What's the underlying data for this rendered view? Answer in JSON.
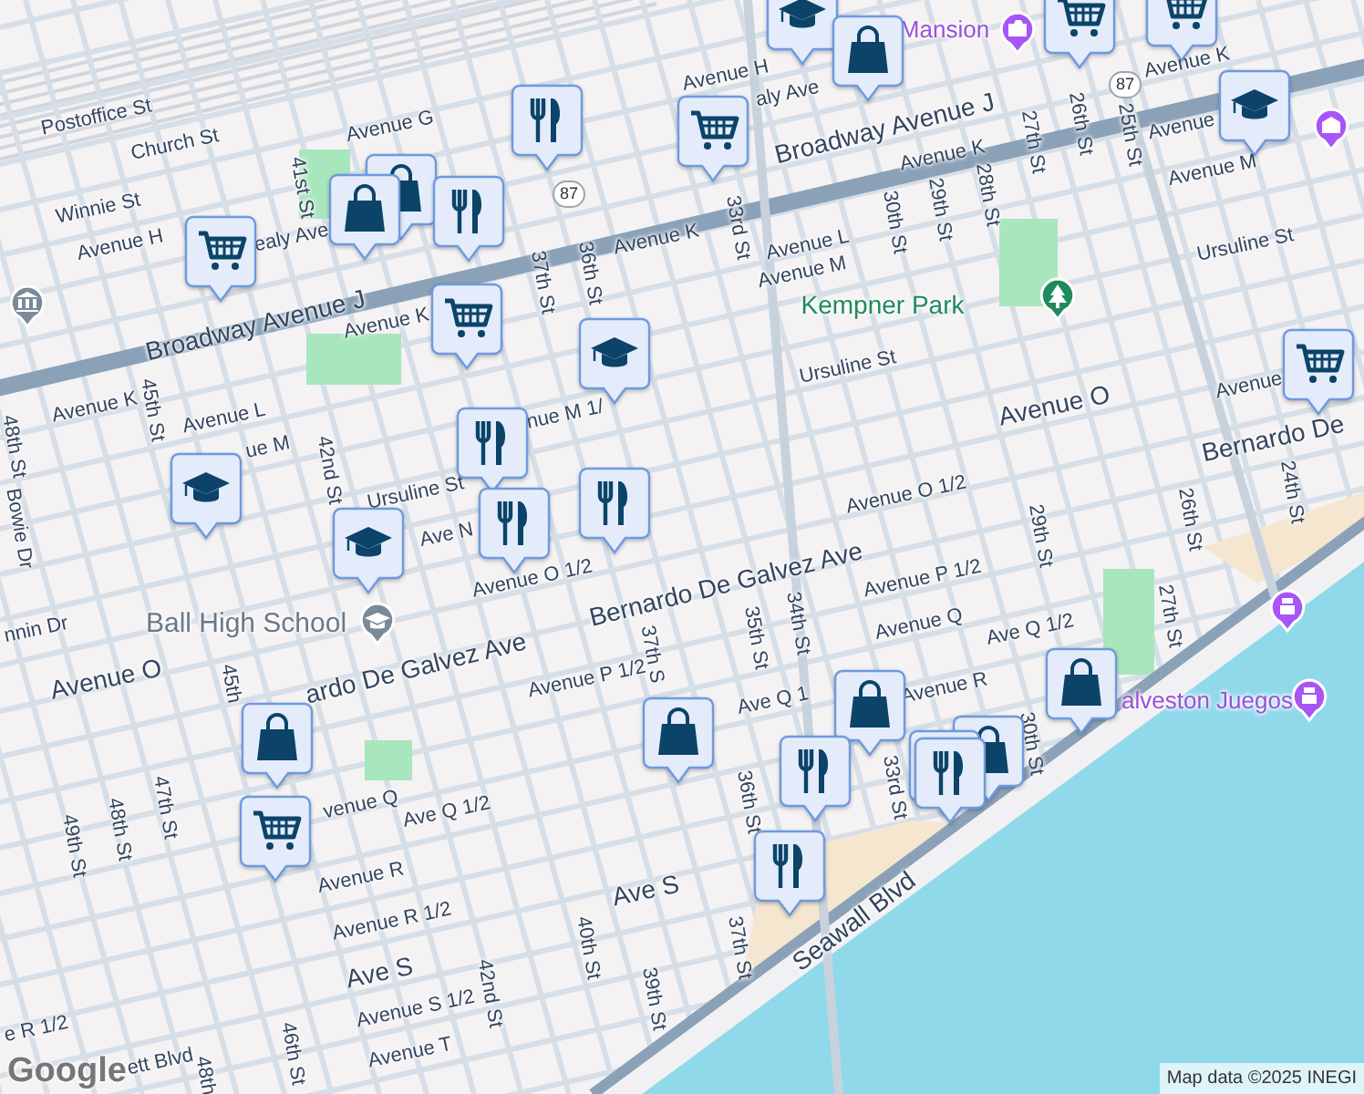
{
  "labels": [
    {
      "text": "Postoffice St",
      "kind": "street"
    },
    {
      "text": "Church St",
      "kind": "street"
    },
    {
      "text": "Avenue G",
      "kind": "street"
    },
    {
      "text": "Winnie St",
      "kind": "street"
    },
    {
      "text": "Avenue H",
      "kind": "street"
    },
    {
      "text": "ealy Ave",
      "kind": "street"
    },
    {
      "text": "41st St",
      "kind": "street"
    },
    {
      "text": "Broadway Avenue J",
      "kind": "major"
    },
    {
      "text": "Avenue K",
      "kind": "street"
    },
    {
      "text": "37th St",
      "kind": "street"
    },
    {
      "text": "36th St",
      "kind": "street"
    },
    {
      "text": "Avenue K",
      "kind": "street"
    },
    {
      "text": "Avenue L",
      "kind": "street"
    },
    {
      "text": "Avenue M",
      "kind": "street"
    },
    {
      "text": "33rd St",
      "kind": "street"
    },
    {
      "text": "30th St",
      "kind": "street"
    },
    {
      "text": "29th St",
      "kind": "street"
    },
    {
      "text": "28th St",
      "kind": "street"
    },
    {
      "text": "27th St",
      "kind": "street"
    },
    {
      "text": "26th St",
      "kind": "street"
    },
    {
      "text": "25th St",
      "kind": "street"
    },
    {
      "text": "Avenue K",
      "kind": "street"
    },
    {
      "text": "Avenue",
      "kind": "street"
    },
    {
      "text": "Avenue M",
      "kind": "street"
    },
    {
      "text": "Ursuline St",
      "kind": "street"
    },
    {
      "text": "Avenue H",
      "kind": "street"
    },
    {
      "text": "aly Ave",
      "kind": "street"
    },
    {
      "text": "Avenue K",
      "kind": "street"
    },
    {
      "text": "Broadway Avenue J",
      "kind": "major"
    },
    {
      "text": "Mansion",
      "kind": "attraction"
    },
    {
      "text": "Kempner Park",
      "kind": "park"
    },
    {
      "text": "Ursuline St",
      "kind": "street"
    },
    {
      "text": "Avenue O",
      "kind": "major"
    },
    {
      "text": "Avenue O 1/2",
      "kind": "street"
    },
    {
      "text": "Avenue",
      "kind": "street"
    },
    {
      "text": "Bernardo De",
      "kind": "major"
    },
    {
      "text": "24th St",
      "kind": "street"
    },
    {
      "text": "26th St",
      "kind": "street"
    },
    {
      "text": "29th St",
      "kind": "street"
    },
    {
      "text": "Avenue P 1/2",
      "kind": "street"
    },
    {
      "text": "Avenue Q",
      "kind": "street"
    },
    {
      "text": "Ave Q 1/2",
      "kind": "street"
    },
    {
      "text": "27th St",
      "kind": "street"
    },
    {
      "text": "alveston Juegos",
      "kind": "attraction"
    },
    {
      "text": "Seawall Blvd",
      "kind": "major"
    },
    {
      "text": "33rd St",
      "kind": "street"
    },
    {
      "text": "30th St",
      "kind": "street"
    },
    {
      "text": "36th St",
      "kind": "street"
    },
    {
      "text": "37th St",
      "kind": "street"
    },
    {
      "text": "35th St",
      "kind": "street"
    },
    {
      "text": "34th St",
      "kind": "street"
    },
    {
      "text": "Ave Q 1",
      "kind": "street"
    },
    {
      "text": "Avenue R",
      "kind": "street"
    },
    {
      "text": "Bernardo De Galvez Ave",
      "kind": "major"
    },
    {
      "text": "ardo De Galvez Ave",
      "kind": "major"
    },
    {
      "text": "Ball High School",
      "kind": "school"
    },
    {
      "text": "Avenue O",
      "kind": "major"
    },
    {
      "text": "Avenue O 1/2",
      "kind": "street"
    },
    {
      "text": "Avenue P 1/2",
      "kind": "street"
    },
    {
      "text": "37th S",
      "kind": "street"
    },
    {
      "text": "45th",
      "kind": "street"
    },
    {
      "text": "49th St",
      "kind": "street"
    },
    {
      "text": "48th St",
      "kind": "street"
    },
    {
      "text": "47th St",
      "kind": "street"
    },
    {
      "text": "venue Q",
      "kind": "street"
    },
    {
      "text": "Ave Q 1/2",
      "kind": "street"
    },
    {
      "text": "Avenue R",
      "kind": "street"
    },
    {
      "text": "Avenue R 1/2",
      "kind": "street"
    },
    {
      "text": "Ave S",
      "kind": "major"
    },
    {
      "text": "Avenue S 1/2",
      "kind": "street"
    },
    {
      "text": "Avenue T",
      "kind": "street"
    },
    {
      "text": "42nd St",
      "kind": "street"
    },
    {
      "text": "40th St",
      "kind": "street"
    },
    {
      "text": "39th St",
      "kind": "street"
    },
    {
      "text": "46th St",
      "kind": "street"
    },
    {
      "text": "48th",
      "kind": "street"
    },
    {
      "text": "ett Blvd",
      "kind": "street"
    },
    {
      "text": "e R 1/2",
      "kind": "street"
    },
    {
      "text": "Ave S",
      "kind": "major"
    },
    {
      "text": "Bowie Dr",
      "kind": "street"
    },
    {
      "text": "nnin Dr",
      "kind": "street"
    },
    {
      "text": "48th St",
      "kind": "street"
    },
    {
      "text": "45th St",
      "kind": "street"
    },
    {
      "text": "Avenue K",
      "kind": "street"
    },
    {
      "text": "Avenue L",
      "kind": "street"
    },
    {
      "text": "ue M",
      "kind": "street"
    },
    {
      "text": "42nd St",
      "kind": "street"
    },
    {
      "text": "nue M 1/",
      "kind": "street"
    },
    {
      "text": "Ursuline St",
      "kind": "street"
    },
    {
      "text": "Ave N",
      "kind": "street"
    }
  ],
  "route_shields": [
    {
      "text": "87"
    },
    {
      "text": "87"
    }
  ],
  "markers": [
    {
      "kind": "school"
    },
    {
      "kind": "bag"
    },
    {
      "kind": "cart"
    },
    {
      "kind": "cart"
    },
    {
      "kind": "cart"
    },
    {
      "kind": "school"
    },
    {
      "kind": "cart"
    },
    {
      "kind": "food"
    },
    {
      "kind": "bag"
    },
    {
      "kind": "bag"
    },
    {
      "kind": "food"
    },
    {
      "kind": "cart"
    },
    {
      "kind": "school"
    },
    {
      "kind": "food"
    },
    {
      "kind": "food"
    },
    {
      "kind": "food"
    },
    {
      "kind": "school"
    },
    {
      "kind": "school"
    },
    {
      "kind": "cart"
    },
    {
      "kind": "bag"
    },
    {
      "kind": "cart"
    },
    {
      "kind": "bag"
    },
    {
      "kind": "bag"
    },
    {
      "kind": "bag"
    },
    {
      "kind": "bag"
    },
    {
      "kind": "food"
    },
    {
      "kind": "food"
    },
    {
      "kind": "food"
    },
    {
      "kind": "food"
    }
  ],
  "logo": "Google",
  "attribution": "Map data ©2025 INEGI"
}
